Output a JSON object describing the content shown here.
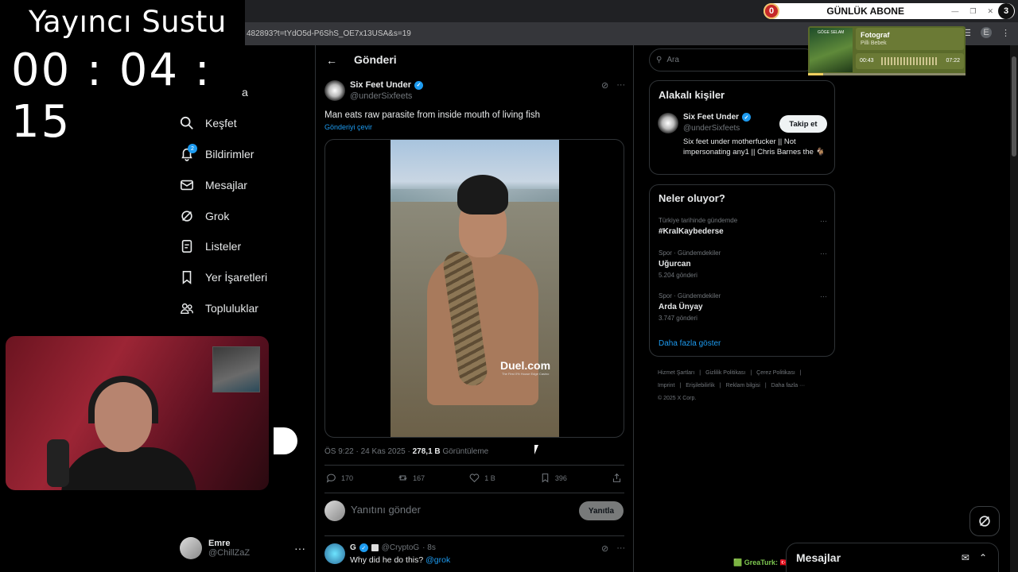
{
  "browser": {
    "url_fragment": "482893?t=tYdO5d-P6ShS_OE7x13USA&s=19",
    "profile_letter": "E"
  },
  "stream_overlay": {
    "title": "Yayıncı Sustu",
    "timer": "00 : 04 : 15",
    "abone_label": "GÜNLÜK ABONE",
    "abone_left": "0",
    "abone_right": "3"
  },
  "nav": {
    "partial_label": "a",
    "items": [
      {
        "label": "Keşfet",
        "icon": "search-icon"
      },
      {
        "label": "Bildirimler",
        "icon": "bell-icon",
        "badge": "2"
      },
      {
        "label": "Mesajlar",
        "icon": "mail-icon"
      },
      {
        "label": "Grok",
        "icon": "grok-icon"
      },
      {
        "label": "Listeler",
        "icon": "list-icon"
      },
      {
        "label": "Yer İşaretleri",
        "icon": "bookmark-icon"
      },
      {
        "label": "Topluluklar",
        "icon": "people-icon"
      }
    ],
    "account": {
      "name": "Emre",
      "handle": "@ChillZaZ",
      "more": "···"
    }
  },
  "post_page": {
    "back": "←",
    "title": "Gönderi",
    "author": {
      "name": "Six Feet Under",
      "handle": "@underSixfeets"
    },
    "text": "Man eats raw parasite from inside mouth of living fish",
    "translate": "Gönderiyi çevir",
    "video_logo": "Duel.com",
    "video_logo_sub": "The First 0% House Edge Casino",
    "time": "ÖS 9:22 · 24 Kas 2025 ·",
    "views_value": "278,1 B",
    "views_label": "Görüntüleme",
    "stats": {
      "replies": "170",
      "reposts": "167",
      "likes": "1 B",
      "bookmarks": "396"
    },
    "reply_placeholder": "Yanıtını gönder",
    "reply_button": "Yanıtla"
  },
  "comment": {
    "name": "G",
    "handle": "@CryptoG",
    "time": "· 8s",
    "text": "Why did he do this?",
    "mention": "@grok"
  },
  "right": {
    "search_placeholder": "Ara",
    "who_title": "Alakalı kişiler",
    "who": {
      "name": "Six Feet Under",
      "handle": "@underSixfeets",
      "bio": "Six feet under motherfucker || Not impersonating any1 || Chris Barnes the 🐐",
      "follow": "Takip et"
    },
    "trends_title": "Neler oluyor?",
    "trends": [
      {
        "context": "Türkiye tarihinde gündemde",
        "name": "#KralKaybederse",
        "count": ""
      },
      {
        "context": "Spor · Gündemdekiler",
        "name": "Uğurcan",
        "count": "5.204 gönderi"
      },
      {
        "context": "Spor · Gündemdekiler",
        "name": "Arda Ünyay",
        "count": "3.747 gönderi"
      }
    ],
    "show_more": "Daha fazla göster",
    "footer": [
      "Hizmet Şartları",
      "|",
      "Gizlilik Politikası",
      "|",
      "Çerez Politikası",
      "|",
      "Imprint",
      "|",
      "Erişilebilirlik",
      "|",
      "Reklam bilgisi",
      "|",
      "Daha fazla ···",
      "© 2025 X Corp."
    ]
  },
  "music": {
    "art_text": "GÖGE SELAM",
    "title": "Fotograf",
    "artist": "Pilli Bebek",
    "elapsed": "00:43",
    "total": "07:22",
    "progress": 0.097
  },
  "messages_drawer": {
    "title": "Mesajlar"
  },
  "chat_overlay": {
    "line": "🟩 GreaTurk: 🇹🇷"
  },
  "colors": {
    "accent": "#1d9bf0",
    "bg": "#000000",
    "border": "#2f3336",
    "muted": "#71767b"
  }
}
